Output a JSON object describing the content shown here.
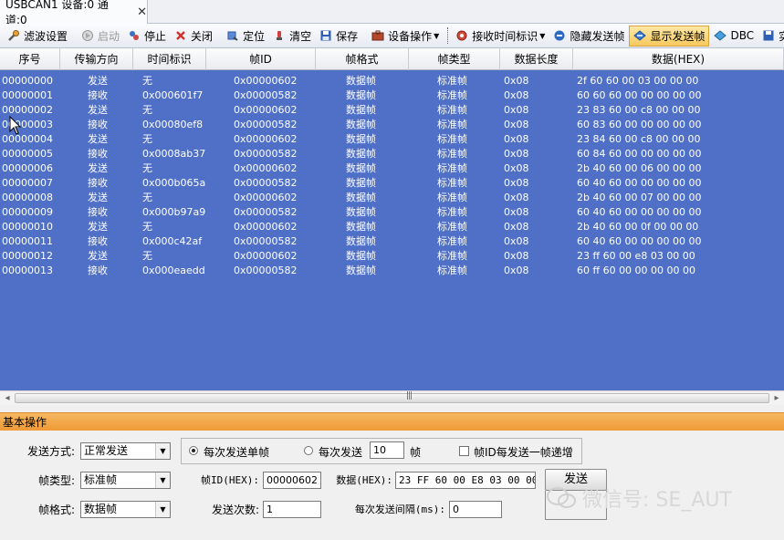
{
  "tab": {
    "title": "USBCAN1 设备:0 通道:0",
    "close": "✕"
  },
  "toolbar": {
    "filter": "滤波设置",
    "start": "启动",
    "stop": "停止",
    "close": "关闭",
    "locate": "定位",
    "clear": "清空",
    "save": "保存",
    "device_ops": "设备操作",
    "rx_timestamp": "接收时间标识",
    "hide_send": "隐藏发送帧",
    "show_send": "显示发送帧",
    "dbc": "DBC",
    "realtime": "实时"
  },
  "grid": {
    "columns": [
      "序号",
      "传输方向",
      "时间标识",
      "帧ID",
      "帧格式",
      "帧类型",
      "数据长度",
      "数据(HEX)"
    ],
    "rows": [
      [
        "00000000",
        "发送",
        "无",
        "0x00000602",
        "数据帧",
        "标准帧",
        "0x08",
        "2f 60 60 00 03 00 00 00"
      ],
      [
        "00000001",
        "接收",
        "0x000601f7",
        "0x00000582",
        "数据帧",
        "标准帧",
        "0x08",
        "60 60 60 00 00 00 00 00"
      ],
      [
        "00000002",
        "发送",
        "无",
        "0x00000602",
        "数据帧",
        "标准帧",
        "0x08",
        "23 83 60 00 c8 00 00 00"
      ],
      [
        "00000003",
        "接收",
        "0x00080ef8",
        "0x00000582",
        "数据帧",
        "标准帧",
        "0x08",
        "60 83 60 00 00 00 00 00"
      ],
      [
        "00000004",
        "发送",
        "无",
        "0x00000602",
        "数据帧",
        "标准帧",
        "0x08",
        "23 84 60 00 c8 00 00 00"
      ],
      [
        "00000005",
        "接收",
        "0x0008ab37",
        "0x00000582",
        "数据帧",
        "标准帧",
        "0x08",
        "60 84 60 00 00 00 00 00"
      ],
      [
        "00000006",
        "发送",
        "无",
        "0x00000602",
        "数据帧",
        "标准帧",
        "0x08",
        "2b 40 60 00 06 00 00 00"
      ],
      [
        "00000007",
        "接收",
        "0x000b065a",
        "0x00000582",
        "数据帧",
        "标准帧",
        "0x08",
        "60 40 60 00 00 00 00 00"
      ],
      [
        "00000008",
        "发送",
        "无",
        "0x00000602",
        "数据帧",
        "标准帧",
        "0x08",
        "2b 40 60 00 07 00 00 00"
      ],
      [
        "00000009",
        "接收",
        "0x000b97a9",
        "0x00000582",
        "数据帧",
        "标准帧",
        "0x08",
        "60 40 60 00 00 00 00 00"
      ],
      [
        "00000010",
        "发送",
        "无",
        "0x00000602",
        "数据帧",
        "标准帧",
        "0x08",
        "2b 40 60 00 0f 00 00 00"
      ],
      [
        "00000011",
        "接收",
        "0x000c42af",
        "0x00000582",
        "数据帧",
        "标准帧",
        "0x08",
        "60 40 60 00 00 00 00 00"
      ],
      [
        "00000012",
        "发送",
        "无",
        "0x00000602",
        "数据帧",
        "标准帧",
        "0x08",
        "23 ff 60 00 e8 03 00 00"
      ],
      [
        "00000013",
        "接收",
        "0x000eaedd",
        "0x00000582",
        "数据帧",
        "标准帧",
        "0x08",
        "60 ff 60 00 00 00 00 00"
      ]
    ]
  },
  "panel": {
    "title": "基本操作",
    "send_mode_label": "发送方式:",
    "send_mode_value": "正常发送",
    "frame_type_label": "帧类型:",
    "frame_type_value": "标准帧",
    "frame_format_label": "帧格式:",
    "frame_format_value": "数据帧",
    "radio_single": "每次发送单帧",
    "radio_multi": "每次发送",
    "multi_count": "10",
    "multi_unit": "帧",
    "increment_label": "帧ID每发送一帧递增",
    "frame_id_label": "帧ID(HEX):",
    "frame_id_value": "00000602",
    "data_label": "数据(HEX):",
    "data_value": "23 FF 60 00 E8 03 00 00",
    "send_button": "发送",
    "send_count_label": "发送次数:",
    "send_count_value": "1",
    "interval_label": "每次发送间隔(ms):",
    "interval_value": "0"
  },
  "watermark": "微信号: SE_AUT",
  "colors": {
    "grid_bg": "#4f70c6",
    "panel_header": "#f0a33f",
    "active_button": "#f7c95d"
  }
}
